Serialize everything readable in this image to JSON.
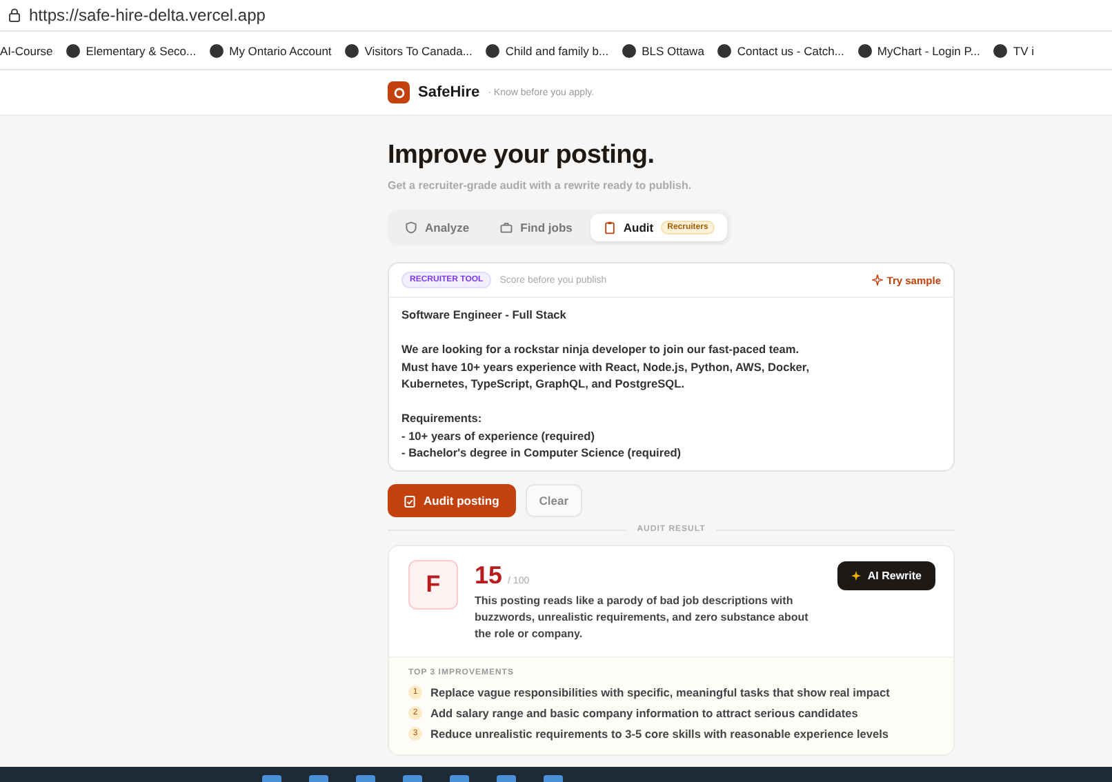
{
  "browser": {
    "url": "https://safe-hire-delta.vercel.app",
    "bookmarks": [
      {
        "label": "AI-Course",
        "has_icon": false
      },
      {
        "label": "Elementary & Seco...",
        "has_icon": true
      },
      {
        "label": "My Ontario Account",
        "has_icon": true
      },
      {
        "label": "Visitors To Canada...",
        "has_icon": true
      },
      {
        "label": "Child and family b...",
        "has_icon": true
      },
      {
        "label": "BLS Ottawa",
        "has_icon": true
      },
      {
        "label": "Contact us - Catch...",
        "has_icon": true
      },
      {
        "label": "MyChart - Login P...",
        "has_icon": true
      },
      {
        "label": "TV i",
        "has_icon": true
      }
    ]
  },
  "header": {
    "brand": "SafeHire",
    "tagline": "· Know before you apply."
  },
  "page": {
    "title": "Improve your posting.",
    "subtitle": "Get a recruiter-grade audit with a rewrite ready to publish."
  },
  "tabs": [
    {
      "label": "Analyze",
      "selected": false
    },
    {
      "label": "Find jobs",
      "selected": false
    },
    {
      "label": "Audit",
      "selected": true,
      "badge": "Recruiters"
    }
  ],
  "editor": {
    "tag": "RECRUITER TOOL",
    "hint": "Score before you publish",
    "sample_link": "Try sample",
    "paragraphs": [
      [
        "Software Engineer - Full Stack"
      ],
      [
        "We are looking for a rockstar ninja developer to join our fast-paced team.",
        "Must have 10+ years experience with React, Node.js, Python, AWS, Docker,",
        "Kubernetes, TypeScript, GraphQL, and PostgreSQL."
      ],
      [
        "Requirements:",
        "- 10+ years of experience (required)",
        "- Bachelor's degree in Computer Science (required)"
      ]
    ]
  },
  "actions": {
    "primary": "Audit posting",
    "secondary": "Clear"
  },
  "result": {
    "divider": "AUDIT RESULT",
    "grade": "F",
    "score": "15",
    "max": "/ 100",
    "summary": "This posting reads like a parody of bad job descriptions with buzzwords, unrealistic requirements, and zero substance about the role or company.",
    "rewrite_button": "AI Rewrite",
    "improvements_title": "TOP 3 IMPROVEMENTS",
    "improvements": [
      {
        "number": "1",
        "text": "Replace vague responsibilities with specific, meaningful tasks that show real impact"
      },
      {
        "number": "2",
        "text": "Add salary range and basic company information to attract serious candidates"
      },
      {
        "number": "3",
        "text": "Reduce unrealistic requirements to 3-5 core skills with reasonable experience levels"
      }
    ]
  }
}
